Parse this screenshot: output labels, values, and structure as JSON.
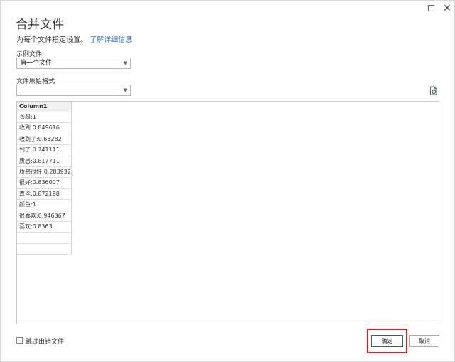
{
  "window": {
    "maximize_icon": "maximize-icon",
    "close_icon": "close-icon",
    "close_glyph": "✕"
  },
  "header": {
    "title": "合并文件",
    "subtitle": "为每个文件指定设置。",
    "learn_more_link": "了解详细信息"
  },
  "sample_file": {
    "label": "示例文件:",
    "value": "第一个文件"
  },
  "file_origin": {
    "label": "文件原始格式",
    "value": ""
  },
  "preview": {
    "column_header": "Column1",
    "rows": [
      "衣服:1",
      "收到:0.849616",
      "收到了:0.63282",
      "到了:0.741111",
      "质感:0.817711",
      "质感很好:0.283932",
      "很好:0.836007",
      "真丝:0.872198",
      "颜色:1",
      "很喜欢:0.946367",
      "喜欢:0.8363",
      "",
      ""
    ]
  },
  "footer": {
    "skip_errors_label": "跳过出错文件",
    "skip_errors_checked": false,
    "ok_label": "确定",
    "cancel_label": "取消"
  },
  "colors": {
    "accent": "#217346",
    "link": "#2a6ebb",
    "highlight": "#e02020"
  }
}
